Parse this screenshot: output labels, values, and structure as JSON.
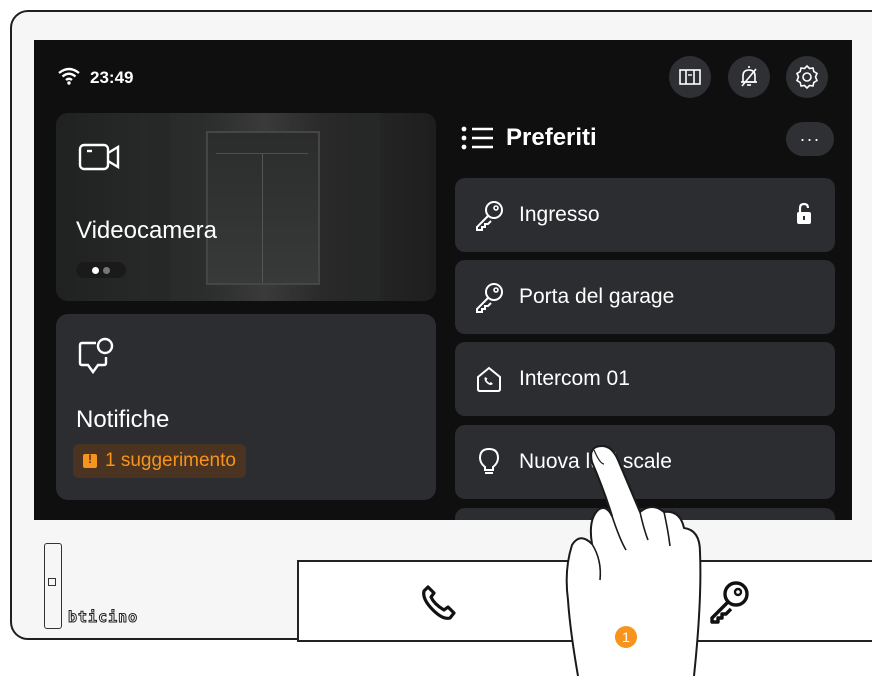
{
  "status": {
    "time": "23:49",
    "wifi_icon": "wifi-icon"
  },
  "top_buttons": [
    {
      "name": "door-panel-icon"
    },
    {
      "name": "bell-off-icon"
    },
    {
      "name": "settings-gear-icon"
    }
  ],
  "video_card": {
    "title": "Videocamera",
    "icon": "video-camera-icon"
  },
  "notifications_card": {
    "title": "Notifiche",
    "icon": "chat-bubble-alert-icon",
    "badge": "1 suggerimento",
    "badge_color": "#f7941d"
  },
  "favorites": {
    "title": "Preferiti",
    "more_label": "···",
    "items": [
      {
        "label": "Ingresso",
        "icon": "key-icon",
        "trailing_icon": "unlock-icon"
      },
      {
        "label": "Porta del garage",
        "icon": "key-icon"
      },
      {
        "label": "Intercom 01",
        "icon": "house-phone-icon"
      },
      {
        "label": "Nuova luci scale",
        "icon": "lightbulb-icon"
      }
    ]
  },
  "brand": "bticino",
  "keypad": {
    "left_icon": "phone-icon",
    "right_icon": "key-icon"
  },
  "callout": {
    "number": "1",
    "color": "#f7941d"
  }
}
